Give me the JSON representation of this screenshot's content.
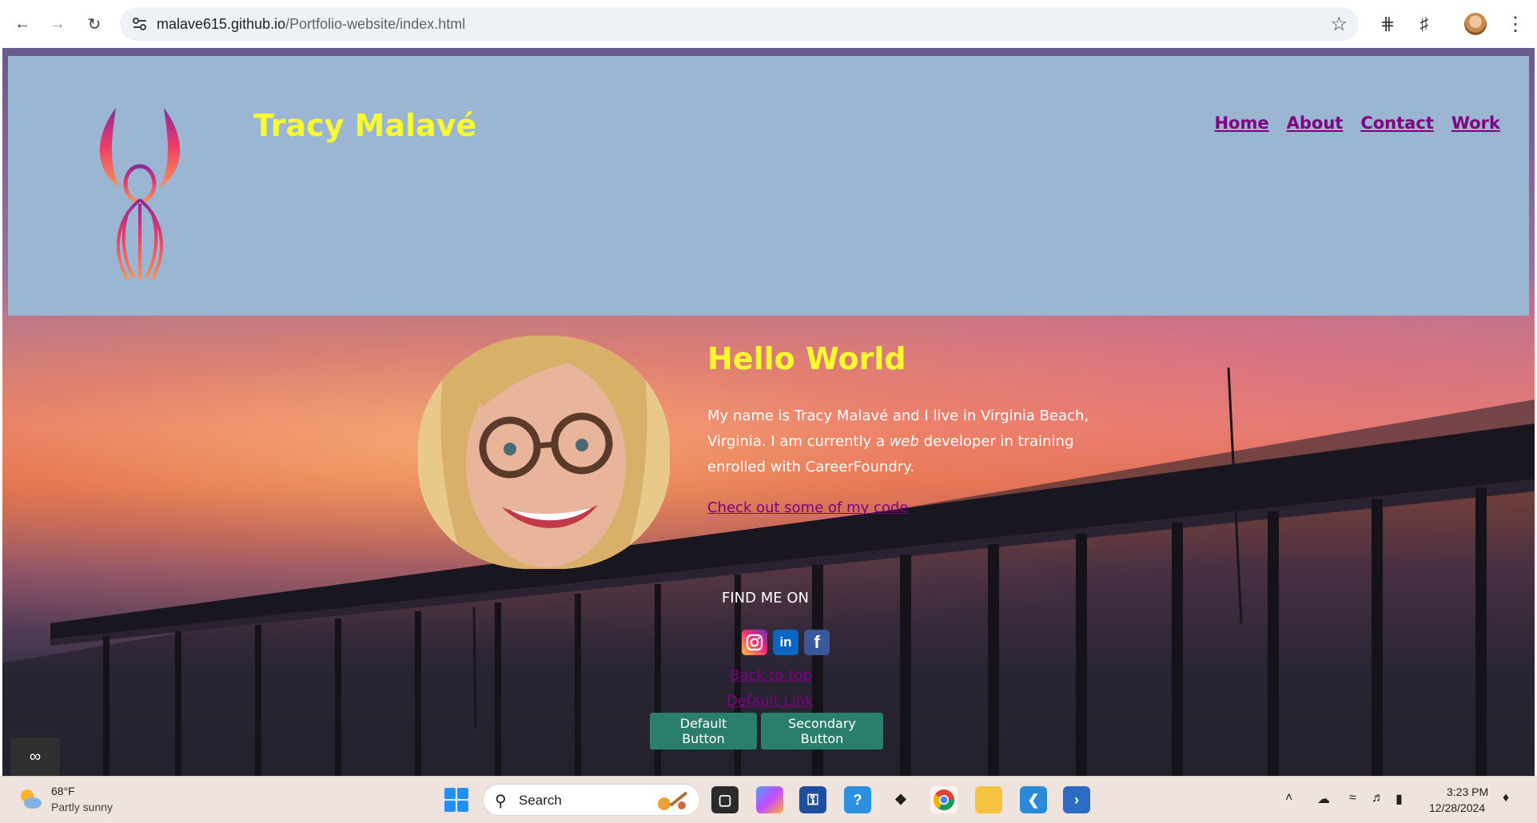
{
  "browser": {
    "url_host": "malave615.github.io",
    "url_path": "/Portfolio-website/index.html"
  },
  "site": {
    "title": "Tracy Malavé",
    "nav": [
      "Home",
      "About",
      "Contact",
      "Work"
    ]
  },
  "intro": {
    "heading": "Hello World",
    "bio_part1": "My name is Tracy Malavé and I live in Virginia Beach, Virginia. I am currently a ",
    "bio_em": "web",
    "bio_part2": " developer in training enrolled with CareerFoundry.",
    "code_link": "Check out some of my code"
  },
  "footer": {
    "find_me": "FIND ME ON",
    "socials": [
      "instagram",
      "linkedin",
      "facebook"
    ],
    "linkedin_text": "in",
    "facebook_text": "f",
    "back_to_top": "Back to top",
    "default_link": "Default Link",
    "default_button": "Default Button",
    "secondary_button": "Secondary Button"
  },
  "colors": {
    "header_band": "#9ab6d3",
    "title_yellow": "#fafa2e",
    "link_purple": "#800080",
    "button_teal": "#2a7f6c"
  },
  "taskbar": {
    "weather_temp": "68°F",
    "weather_desc": "Partly sunny",
    "search_placeholder": "Search",
    "time": "3:23 PM",
    "date": "12/28/2024"
  }
}
